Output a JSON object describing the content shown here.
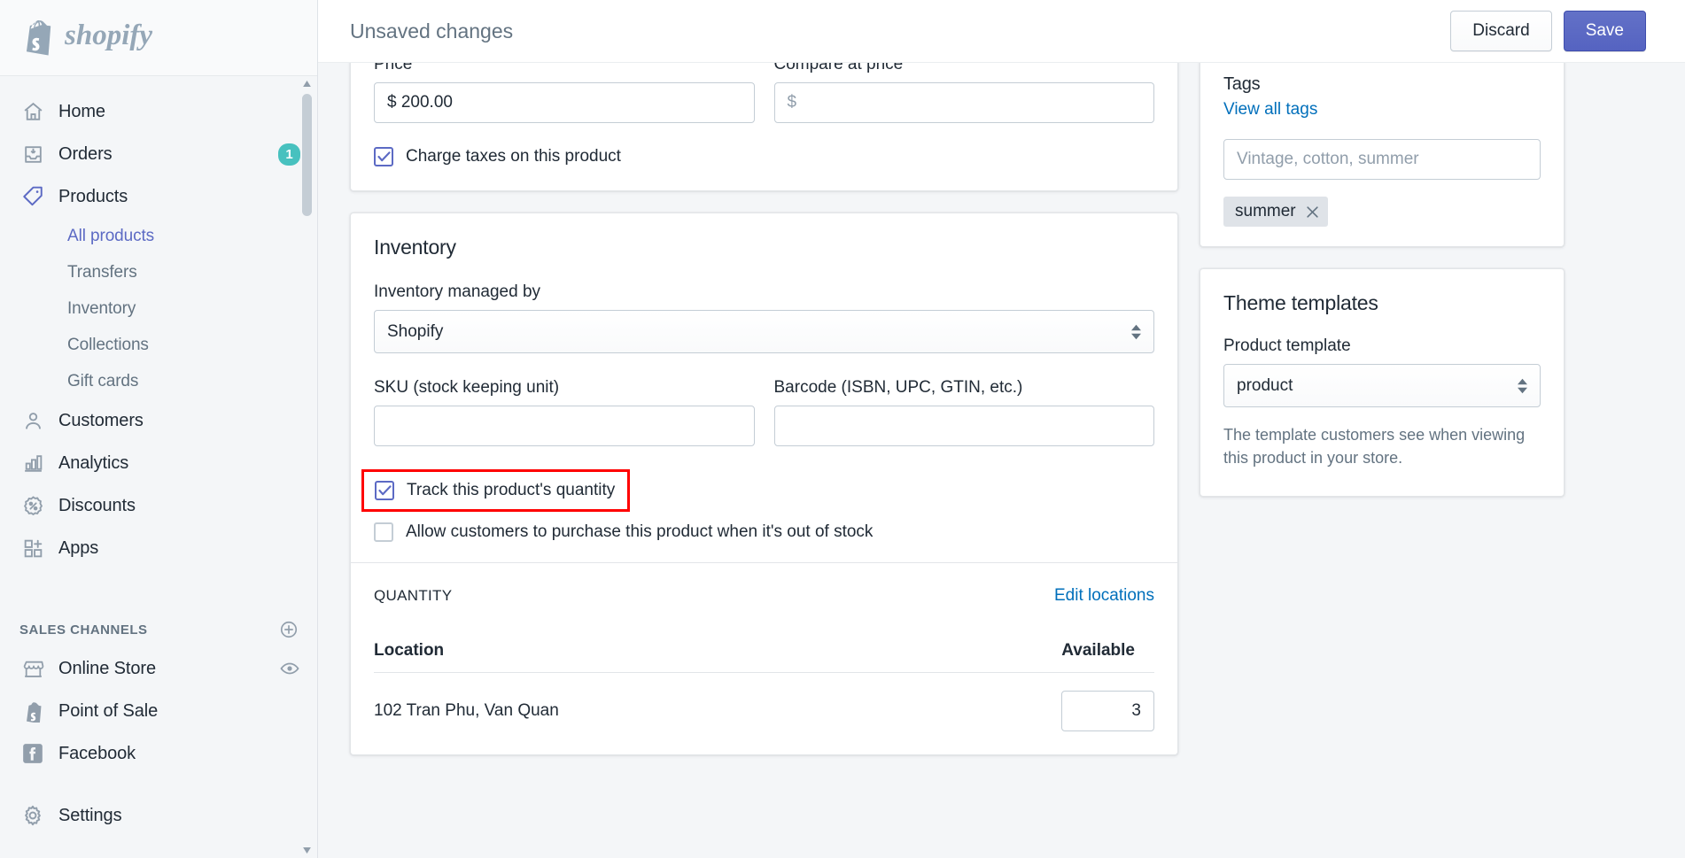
{
  "brand": {
    "name": "shopify"
  },
  "topbar": {
    "title": "Unsaved changes",
    "discard_label": "Discard",
    "save_label": "Save"
  },
  "sidebar": {
    "items": [
      {
        "label": "Home",
        "icon": "home-icon"
      },
      {
        "label": "Orders",
        "icon": "orders-icon",
        "badge": "1"
      },
      {
        "label": "Products",
        "icon": "products-tag-icon"
      },
      {
        "label": "Customers",
        "icon": "customer-icon"
      },
      {
        "label": "Analytics",
        "icon": "analytics-bars-icon"
      },
      {
        "label": "Discounts",
        "icon": "discount-percent-icon"
      },
      {
        "label": "Apps",
        "icon": "apps-grid-plus-icon"
      }
    ],
    "product_subitems": [
      {
        "label": "All products",
        "active": true
      },
      {
        "label": "Transfers",
        "active": false
      },
      {
        "label": "Inventory",
        "active": false
      },
      {
        "label": "Collections",
        "active": false
      },
      {
        "label": "Gift cards",
        "active": false
      }
    ],
    "sales_channels_title": "SALES CHANNELS",
    "sales_channels": [
      {
        "label": "Online Store",
        "icon": "storefront-icon",
        "trailing_icon": "eye-icon"
      },
      {
        "label": "Point of Sale",
        "icon": "pos-shopify-bag-icon"
      },
      {
        "label": "Facebook",
        "icon": "facebook-icon"
      }
    ],
    "settings": {
      "label": "Settings",
      "icon": "gear-icon"
    }
  },
  "pricing": {
    "price_label": "Price",
    "price_value": "$ 200.00",
    "compare_label": "Compare at price",
    "compare_placeholder": "$",
    "charge_taxes_label": "Charge taxes on this product",
    "charge_taxes_checked": true
  },
  "inventory": {
    "title": "Inventory",
    "managed_by_label": "Inventory managed by",
    "managed_by_value": "Shopify",
    "sku_label": "SKU (stock keeping unit)",
    "sku_value": "",
    "barcode_label": "Barcode (ISBN, UPC, GTIN, etc.)",
    "barcode_value": "",
    "track_quantity_label": "Track this product's quantity",
    "track_quantity_checked": true,
    "allow_oversell_label": "Allow customers to purchase this product when it's out of stock",
    "allow_oversell_checked": false,
    "quantity_section_label": "QUANTITY",
    "edit_locations_label": "Edit locations",
    "table": {
      "columns": [
        "Location",
        "Available"
      ],
      "rows": [
        {
          "location": "102 Tran Phu, Van Quan",
          "available": "3"
        }
      ]
    }
  },
  "tags_card": {
    "title": "Tags",
    "view_all_label": "View all tags",
    "input_placeholder": "Vintage, cotton, summer",
    "input_value": "",
    "chips": [
      {
        "label": "summer"
      }
    ]
  },
  "theme_card": {
    "title": "Theme templates",
    "product_template_label": "Product template",
    "product_template_value": "product",
    "help_text": "The template customers see when viewing this product in your store."
  },
  "colors": {
    "accent": "#5c6ac4",
    "link": "#006fbb",
    "badge": "#47c1bf",
    "highlight": "#ff0000"
  }
}
